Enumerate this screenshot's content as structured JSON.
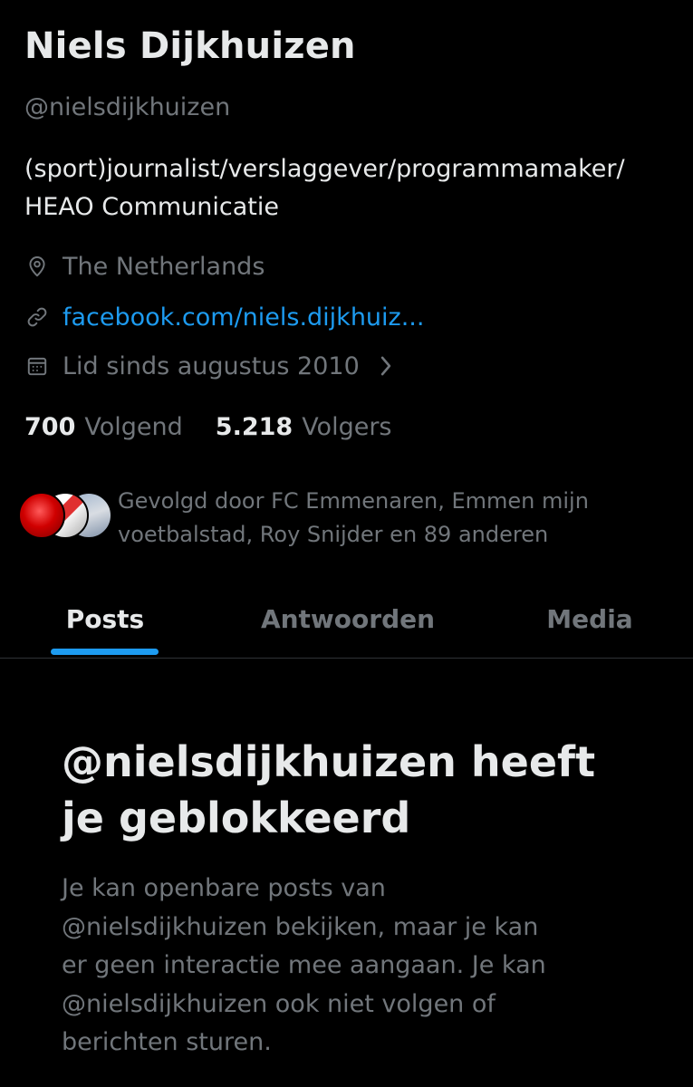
{
  "profile": {
    "name": "Niels Dijkhuizen",
    "handle": "@nielsdijkhuizen",
    "bio_lines": [
      "(sport)journalist/verslaggever/programmamaker/",
      "HEAO Communicatie"
    ],
    "location": "The Netherlands",
    "link": "facebook.com/niels.dijkhuiz...",
    "joined": "Lid sinds augustus 2010"
  },
  "stats": {
    "following_count": "700",
    "following_label": "Volgend",
    "followers_count": "5.218",
    "followers_label": "Volgers"
  },
  "followed_by": {
    "lines": [
      "Gevolgd door FC Emmenaren, Emmen mijn",
      "voetbalstad, Roy Snijder en 89 anderen"
    ]
  },
  "tabs": [
    {
      "label": "Posts",
      "active": true
    },
    {
      "label": "Antwoorden",
      "active": false
    },
    {
      "label": "Media",
      "active": false
    }
  ],
  "blocked": {
    "title_lines": [
      "@nielsdijkhuizen heeft",
      "je geblokkeerd"
    ],
    "body_lines": [
      "Je kan openbare posts van",
      "@nielsdijkhuizen bekijken, maar je kan",
      "er geen interactie mee aangaan. Je kan",
      "@nielsdijkhuizen ook niet volgen of",
      "berichten sturen."
    ]
  },
  "colors": {
    "background": "#000000",
    "text_primary": "#e7e9ea",
    "text_secondary": "#71767b",
    "accent": "#1d9bf0",
    "divider": "#2f3336"
  },
  "icons": {
    "location": "location-pin-icon",
    "link": "link-icon",
    "joined": "calendar-icon",
    "chevron": "chevron-right-icon"
  }
}
